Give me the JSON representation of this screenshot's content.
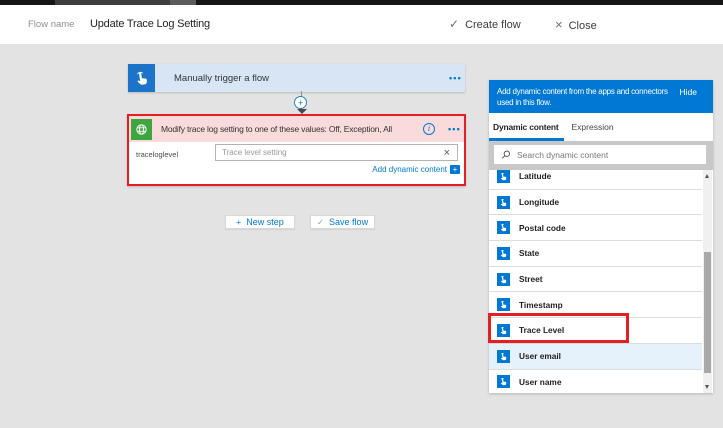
{
  "header": {
    "flow_name_label": "Flow name",
    "flow_title": "Update Trace Log Setting",
    "create_flow_label": "Create flow",
    "create_flow_glyph": "✓",
    "close_label": "Close",
    "close_glyph": "×"
  },
  "canvas": {
    "trigger_card": {
      "title": "Manually trigger a flow",
      "menu_glyph": "•••"
    },
    "connector_plus_glyph": "+",
    "action_card": {
      "title": "Modify trace log setting to one of these values: Off, Exception, All",
      "info_glyph": "i",
      "menu_glyph": "•••",
      "field_label": "traceloglevel",
      "field_placeholder": "Trace level setting",
      "clear_glyph": "×",
      "add_dynamic_content_label": "Add dynamic content",
      "add_dynamic_content_plus": "+"
    },
    "buttons": {
      "new_step_glyph": "+",
      "new_step_label": "New step",
      "save_flow_glyph": "✓",
      "save_flow_label": "Save flow"
    }
  },
  "panel": {
    "header_line1": "Add dynamic content from the apps and connectors",
    "header_line2": "used in this flow.",
    "hide_label": "Hide",
    "tabs": [
      {
        "label": "Dynamic content",
        "active": true
      },
      {
        "label": "Expression",
        "active": false
      }
    ],
    "search_placeholder": "Search dynamic content",
    "items": [
      {
        "label": "Latitude",
        "selected": false,
        "annotated": false
      },
      {
        "label": "Longitude",
        "selected": false,
        "annotated": false
      },
      {
        "label": "Postal code",
        "selected": false,
        "annotated": false
      },
      {
        "label": "State",
        "selected": false,
        "annotated": false
      },
      {
        "label": "Street",
        "selected": false,
        "annotated": false
      },
      {
        "label": "Timestamp",
        "selected": false,
        "annotated": false
      },
      {
        "label": "Trace Level",
        "selected": false,
        "annotated": true
      },
      {
        "label": "User email",
        "selected": true,
        "annotated": false
      },
      {
        "label": "User name",
        "selected": false,
        "annotated": false
      }
    ]
  },
  "colors": {
    "accent_blue": "#0078d4",
    "trigger_icon_blue": "#1b74c9",
    "trigger_card_bg": "#d7e5f4",
    "action_icon_green": "#3fa53f",
    "action_header_pink": "#fadbdc",
    "annotation_red": "#e41e25",
    "canvas_gray": "#e3e3e3",
    "selected_row_bg": "#e5f1fb"
  }
}
